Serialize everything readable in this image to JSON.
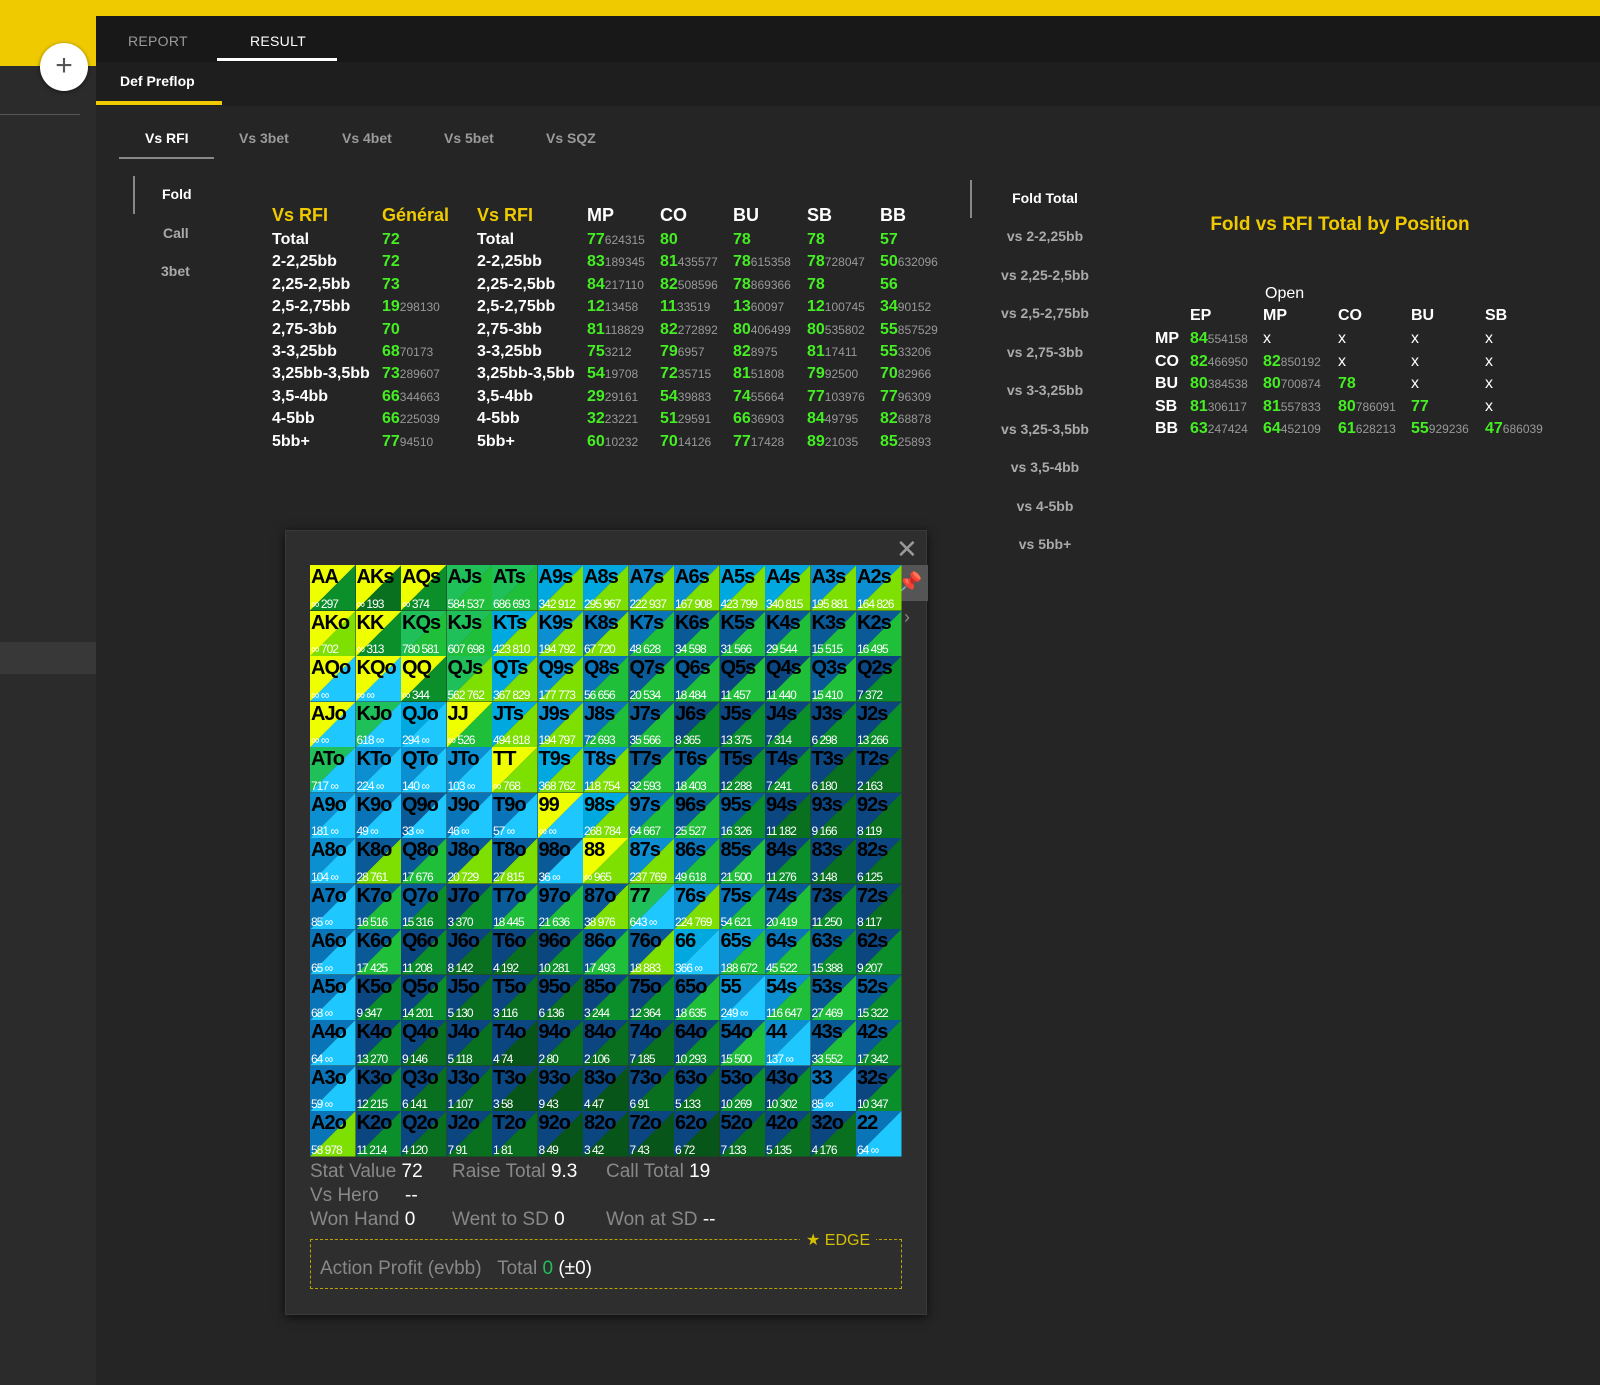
{
  "tabs": [
    {
      "label": "REPORT"
    },
    {
      "label": "RESULT"
    }
  ],
  "sub_tab": "Def Preflop",
  "vs_tabs": [
    "Vs RFI",
    "Vs 3bet",
    "Vs 4bet",
    "Vs 5bet",
    "Vs SQZ"
  ],
  "side_nav": [
    "Fold",
    "Call",
    "3bet"
  ],
  "general_table": {
    "header": [
      "Vs RFI",
      "Général"
    ],
    "rows": [
      [
        "Total",
        "72",
        ""
      ],
      [
        "2-2,25bb",
        "72",
        ""
      ],
      [
        "2,25-2,5bb",
        "73",
        ""
      ],
      [
        "2,5-2,75bb",
        "19",
        "298130"
      ],
      [
        "2,75-3bb",
        "70",
        ""
      ],
      [
        "3-3,25bb",
        "68",
        "70173"
      ],
      [
        "3,25bb-3,5bb",
        "73",
        "289607"
      ],
      [
        "3,5-4bb",
        "66",
        "344663"
      ],
      [
        "4-5bb",
        "66",
        "225039"
      ],
      [
        "5bb+",
        "77",
        "94510"
      ]
    ]
  },
  "position_table": {
    "header": [
      "Vs RFI",
      "MP",
      "CO",
      "BU",
      "SB",
      "BB"
    ],
    "rows": [
      {
        "label": "Total",
        "cells": [
          [
            "77",
            "624315"
          ],
          [
            "80",
            ""
          ],
          [
            "78",
            ""
          ],
          [
            "78",
            ""
          ],
          [
            "57",
            ""
          ]
        ]
      },
      {
        "label": "2-2,25bb",
        "cells": [
          [
            "83",
            "189345"
          ],
          [
            "81",
            "435577"
          ],
          [
            "78",
            "615358"
          ],
          [
            "78",
            "728047"
          ],
          [
            "50",
            "632096"
          ]
        ]
      },
      {
        "label": "2,25-2,5bb",
        "cells": [
          [
            "84",
            "217110"
          ],
          [
            "82",
            "508596"
          ],
          [
            "78",
            "869366"
          ],
          [
            "78",
            ""
          ],
          [
            "56",
            ""
          ]
        ]
      },
      {
        "label": "2,5-2,75bb",
        "cells": [
          [
            "12",
            "13458"
          ],
          [
            "11",
            "33519"
          ],
          [
            "13",
            "60097"
          ],
          [
            "12",
            "100745"
          ],
          [
            "34",
            "90152"
          ]
        ]
      },
      {
        "label": "2,75-3bb",
        "cells": [
          [
            "81",
            "118829"
          ],
          [
            "82",
            "272892"
          ],
          [
            "80",
            "406499"
          ],
          [
            "80",
            "535802"
          ],
          [
            "55",
            "857529"
          ]
        ]
      },
      {
        "label": "3-3,25bb",
        "cells": [
          [
            "75",
            "3212"
          ],
          [
            "79",
            "6957"
          ],
          [
            "82",
            "8975"
          ],
          [
            "81",
            "17411"
          ],
          [
            "55",
            "33206"
          ]
        ]
      },
      {
        "label": "3,25bb-3,5bb",
        "cells": [
          [
            "54",
            "19708"
          ],
          [
            "72",
            "35715"
          ],
          [
            "81",
            "51808"
          ],
          [
            "79",
            "92500"
          ],
          [
            "70",
            "82966"
          ]
        ]
      },
      {
        "label": "3,5-4bb",
        "cells": [
          [
            "29",
            "29161"
          ],
          [
            "54",
            "39883"
          ],
          [
            "74",
            "55664"
          ],
          [
            "77",
            "103976"
          ],
          [
            "77",
            "96309"
          ]
        ]
      },
      {
        "label": "4-5bb",
        "cells": [
          [
            "32",
            "23221"
          ],
          [
            "51",
            "29591"
          ],
          [
            "66",
            "36903"
          ],
          [
            "84",
            "49795"
          ],
          [
            "82",
            "68878"
          ]
        ]
      },
      {
        "label": "5bb+",
        "cells": [
          [
            "60",
            "10232"
          ],
          [
            "70",
            "14126"
          ],
          [
            "77",
            "17428"
          ],
          [
            "89",
            "21035"
          ],
          [
            "85",
            "25893"
          ]
        ]
      }
    ]
  },
  "fold_total": {
    "title": "Fold Total",
    "items": [
      "vs 2-2,25bb",
      "vs 2,25-2,5bb",
      "vs 2,5-2,75bb",
      "vs 2,75-3bb",
      "vs 3-3,25bb",
      "vs 3,25-3,5bb",
      "vs 3,5-4bb",
      "vs 4-5bb",
      "vs 5bb+"
    ]
  },
  "fold_by_position": {
    "title": "Fold vs RFI Total by Position",
    "open_label": "Open",
    "cols": [
      "EP",
      "MP",
      "CO",
      "BU",
      "SB"
    ],
    "rows": [
      {
        "label": "MP",
        "cells": [
          [
            "84",
            "554158"
          ],
          [
            "x",
            ""
          ],
          [
            "x",
            ""
          ],
          [
            "x",
            ""
          ],
          [
            "x",
            ""
          ]
        ]
      },
      {
        "label": "CO",
        "cells": [
          [
            "82",
            "466950"
          ],
          [
            "82",
            "850192"
          ],
          [
            "x",
            ""
          ],
          [
            "x",
            ""
          ],
          [
            "x",
            ""
          ]
        ]
      },
      {
        "label": "BU",
        "cells": [
          [
            "80",
            "384538"
          ],
          [
            "80",
            "700874"
          ],
          [
            "78",
            ""
          ],
          [
            "x",
            ""
          ],
          [
            "x",
            ""
          ]
        ]
      },
      {
        "label": "SB",
        "cells": [
          [
            "81",
            "306117"
          ],
          [
            "81",
            "557833"
          ],
          [
            "80",
            "786091"
          ],
          [
            "77",
            ""
          ],
          [
            "x",
            ""
          ]
        ]
      },
      {
        "label": "BB",
        "cells": [
          [
            "63",
            "247424"
          ],
          [
            "64",
            "452109"
          ],
          [
            "61",
            "628213"
          ],
          [
            "55",
            "929236"
          ],
          [
            "47",
            "686039"
          ]
        ]
      }
    ]
  },
  "hand_grid": {
    "rows": [
      [
        [
          "AA",
          "∞",
          "297"
        ],
        [
          "AKs",
          "∞",
          "193"
        ],
        [
          "AQs",
          "∞",
          "374"
        ],
        [
          "AJs",
          "584",
          "537"
        ],
        [
          "ATs",
          "686",
          "693"
        ],
        [
          "A9s",
          "342",
          "912"
        ],
        [
          "A8s",
          "295",
          "967"
        ],
        [
          "A7s",
          "222",
          "937"
        ],
        [
          "A6s",
          "167",
          "908"
        ],
        [
          "A5s",
          "423",
          "799"
        ],
        [
          "A4s",
          "340",
          "815"
        ],
        [
          "A3s",
          "195",
          "881"
        ],
        [
          "A2s",
          "164",
          "826"
        ]
      ],
      [
        [
          "AKo",
          "∞",
          "702"
        ],
        [
          "KK",
          "∞",
          "313"
        ],
        [
          "KQs",
          "780",
          "581"
        ],
        [
          "KJs",
          "607",
          "698"
        ],
        [
          "KTs",
          "423",
          "810"
        ],
        [
          "K9s",
          "194",
          "792"
        ],
        [
          "K8s",
          "67",
          "720"
        ],
        [
          "K7s",
          "48",
          "628"
        ],
        [
          "K6s",
          "34",
          "598"
        ],
        [
          "K5s",
          "31",
          "566"
        ],
        [
          "K4s",
          "29",
          "544"
        ],
        [
          "K3s",
          "15",
          "515"
        ],
        [
          "K2s",
          "16",
          "495"
        ]
      ],
      [
        [
          "AQo",
          "∞",
          "∞"
        ],
        [
          "KQo",
          "∞",
          "∞"
        ],
        [
          "QQ",
          "∞",
          "344"
        ],
        [
          "QJs",
          "562",
          "762"
        ],
        [
          "QTs",
          "367",
          "829"
        ],
        [
          "Q9s",
          "177",
          "773"
        ],
        [
          "Q8s",
          "56",
          "656"
        ],
        [
          "Q7s",
          "20",
          "534"
        ],
        [
          "Q6s",
          "18",
          "484"
        ],
        [
          "Q5s",
          "11",
          "457"
        ],
        [
          "Q4s",
          "11",
          "440"
        ],
        [
          "Q3s",
          "15",
          "410"
        ],
        [
          "Q2s",
          "7",
          "372"
        ]
      ],
      [
        [
          "AJo",
          "∞",
          "∞"
        ],
        [
          "KJo",
          "618",
          "∞"
        ],
        [
          "QJo",
          "294",
          "∞"
        ],
        [
          "JJ",
          "∞",
          "526"
        ],
        [
          "JTs",
          "494",
          "818"
        ],
        [
          "J9s",
          "194",
          "797"
        ],
        [
          "J8s",
          "72",
          "693"
        ],
        [
          "J7s",
          "35",
          "566"
        ],
        [
          "J6s",
          "8",
          "365"
        ],
        [
          "J5s",
          "13",
          "375"
        ],
        [
          "J4s",
          "7",
          "314"
        ],
        [
          "J3s",
          "6",
          "298"
        ],
        [
          "J2s",
          "13",
          "266"
        ]
      ],
      [
        [
          "ATo",
          "717",
          "∞"
        ],
        [
          "KTo",
          "224",
          "∞"
        ],
        [
          "QTo",
          "140",
          "∞"
        ],
        [
          "JTo",
          "103",
          "∞"
        ],
        [
          "TT",
          "∞",
          "768"
        ],
        [
          "T9s",
          "368",
          "762"
        ],
        [
          "T8s",
          "118",
          "754"
        ],
        [
          "T7s",
          "32",
          "593"
        ],
        [
          "T6s",
          "18",
          "403"
        ],
        [
          "T5s",
          "12",
          "288"
        ],
        [
          "T4s",
          "7",
          "241"
        ],
        [
          "T3s",
          "6",
          "180"
        ],
        [
          "T2s",
          "2",
          "163"
        ]
      ],
      [
        [
          "A9o",
          "181",
          "∞"
        ],
        [
          "K9o",
          "49",
          "∞"
        ],
        [
          "Q9o",
          "33",
          "∞"
        ],
        [
          "J9o",
          "46",
          "∞"
        ],
        [
          "T9o",
          "57",
          "∞"
        ],
        [
          "99",
          "∞",
          "∞"
        ],
        [
          "98s",
          "268",
          "784"
        ],
        [
          "97s",
          "64",
          "667"
        ],
        [
          "96s",
          "25",
          "527"
        ],
        [
          "95s",
          "16",
          "326"
        ],
        [
          "94s",
          "11",
          "182"
        ],
        [
          "93s",
          "9",
          "166"
        ],
        [
          "92s",
          "8",
          "119"
        ]
      ],
      [
        [
          "A8o",
          "104",
          "∞"
        ],
        [
          "K8o",
          "28",
          "761"
        ],
        [
          "Q8o",
          "17",
          "676"
        ],
        [
          "J8o",
          "20",
          "729"
        ],
        [
          "T8o",
          "27",
          "815"
        ],
        [
          "98o",
          "36",
          "∞"
        ],
        [
          "88",
          "∞",
          "965"
        ],
        [
          "87s",
          "237",
          "769"
        ],
        [
          "86s",
          "49",
          "618"
        ],
        [
          "85s",
          "21",
          "500"
        ],
        [
          "84s",
          "11",
          "276"
        ],
        [
          "83s",
          "3",
          "148"
        ],
        [
          "82s",
          "6",
          "125"
        ]
      ],
      [
        [
          "A7o",
          "85",
          "∞"
        ],
        [
          "K7o",
          "16",
          "516"
        ],
        [
          "Q7o",
          "15",
          "316"
        ],
        [
          "J7o",
          "3",
          "370"
        ],
        [
          "T7o",
          "18",
          "445"
        ],
        [
          "97o",
          "21",
          "636"
        ],
        [
          "87o",
          "38",
          "976"
        ],
        [
          "77",
          "643",
          "∞"
        ],
        [
          "76s",
          "224",
          "769"
        ],
        [
          "75s",
          "54",
          "621"
        ],
        [
          "74s",
          "20",
          "419"
        ],
        [
          "73s",
          "11",
          "250"
        ],
        [
          "72s",
          "8",
          "117"
        ]
      ],
      [
        [
          "A6o",
          "65",
          "∞"
        ],
        [
          "K6o",
          "17",
          "425"
        ],
        [
          "Q6o",
          "11",
          "208"
        ],
        [
          "J6o",
          "8",
          "142"
        ],
        [
          "T6o",
          "4",
          "192"
        ],
        [
          "96o",
          "10",
          "281"
        ],
        [
          "86o",
          "17",
          "493"
        ],
        [
          "76o",
          "18",
          "883"
        ],
        [
          "66",
          "366",
          "∞"
        ],
        [
          "65s",
          "188",
          "672"
        ],
        [
          "64s",
          "45",
          "522"
        ],
        [
          "63s",
          "15",
          "388"
        ],
        [
          "62s",
          "9",
          "207"
        ]
      ],
      [
        [
          "A5o",
          "68",
          "∞"
        ],
        [
          "K5o",
          "9",
          "347"
        ],
        [
          "Q5o",
          "14",
          "201"
        ],
        [
          "J5o",
          "5",
          "130"
        ],
        [
          "T5o",
          "3",
          "116"
        ],
        [
          "95o",
          "6",
          "136"
        ],
        [
          "85o",
          "3",
          "244"
        ],
        [
          "75o",
          "12",
          "364"
        ],
        [
          "65o",
          "18",
          "635"
        ],
        [
          "55",
          "249",
          "∞"
        ],
        [
          "54s",
          "116",
          "647"
        ],
        [
          "53s",
          "27",
          "469"
        ],
        [
          "52s",
          "15",
          "322"
        ]
      ],
      [
        [
          "A4o",
          "64",
          "∞"
        ],
        [
          "K4o",
          "13",
          "270"
        ],
        [
          "Q4o",
          "9",
          "146"
        ],
        [
          "J4o",
          "5",
          "118"
        ],
        [
          "T4o",
          "4",
          "74"
        ],
        [
          "94o",
          "2",
          "80"
        ],
        [
          "84o",
          "2",
          "106"
        ],
        [
          "74o",
          "7",
          "185"
        ],
        [
          "64o",
          "10",
          "293"
        ],
        [
          "54o",
          "15",
          "500"
        ],
        [
          "44",
          "137",
          "∞"
        ],
        [
          "43s",
          "33",
          "552"
        ],
        [
          "42s",
          "17",
          "342"
        ]
      ],
      [
        [
          "A3o",
          "59",
          "∞"
        ],
        [
          "K3o",
          "12",
          "215"
        ],
        [
          "Q3o",
          "6",
          "141"
        ],
        [
          "J3o",
          "1",
          "107"
        ],
        [
          "T3o",
          "3",
          "58"
        ],
        [
          "93o",
          "9",
          "43"
        ],
        [
          "83o",
          "4",
          "47"
        ],
        [
          "73o",
          "6",
          "91"
        ],
        [
          "63o",
          "5",
          "133"
        ],
        [
          "53o",
          "10",
          "269"
        ],
        [
          "43o",
          "10",
          "302"
        ],
        [
          "33",
          "85",
          "∞"
        ],
        [
          "32s",
          "10",
          "347"
        ]
      ],
      [
        [
          "A2o",
          "58",
          "978"
        ],
        [
          "K2o",
          "11",
          "214"
        ],
        [
          "Q2o",
          "4",
          "120"
        ],
        [
          "J2o",
          "7",
          "91"
        ],
        [
          "T2o",
          "1",
          "81"
        ],
        [
          "92o",
          "8",
          "49"
        ],
        [
          "82o",
          "3",
          "42"
        ],
        [
          "72o",
          "7",
          "43"
        ],
        [
          "62o",
          "6",
          "72"
        ],
        [
          "52o",
          "7",
          "133"
        ],
        [
          "42o",
          "5",
          "135"
        ],
        [
          "32o",
          "4",
          "176"
        ],
        [
          "22",
          "64",
          "∞"
        ]
      ]
    ]
  },
  "stats": {
    "stat_value_label": "Stat Value",
    "stat_value": "72",
    "raise_total_label": "Raise Total",
    "raise_total": "9.3",
    "call_total_label": "Call Total",
    "call_total": "19",
    "vs_hero_label": "Vs Hero",
    "vs_hero": "--",
    "won_hand_label": "Won Hand",
    "won_hand": "0",
    "went_sd_label": "Went to SD",
    "went_sd": "0",
    "won_sd_label": "Won at SD",
    "won_sd": "--",
    "edge_label": "EDGE",
    "action_profit_label": "Action Profit (evbb)",
    "total_label": "Total",
    "total_value": "0",
    "total_pm": "(±0)"
  },
  "colors": {
    "accent": "#f0ca00",
    "value_green": "#44ee22"
  }
}
